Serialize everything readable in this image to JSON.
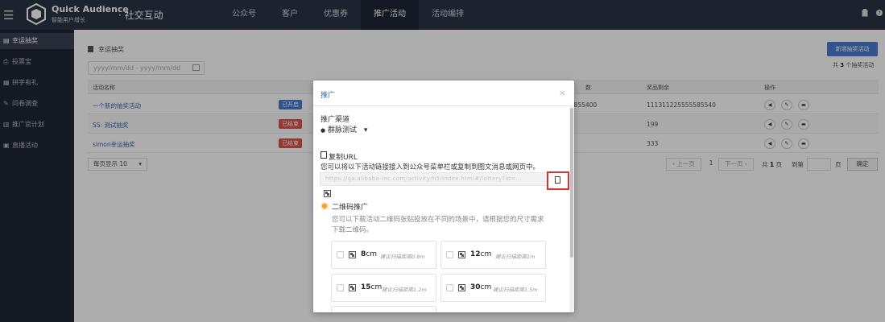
{
  "app": {
    "brand_line1": "Quick Audience",
    "brand_line2": "智能用户增长",
    "section": "· 社交互动"
  },
  "nav": {
    "items": [
      {
        "label": "公众号",
        "active": false
      },
      {
        "label": "客户",
        "active": false
      },
      {
        "label": "优惠券",
        "active": false
      },
      {
        "label": "推广活动",
        "active": true
      },
      {
        "label": "活动编排",
        "active": false
      }
    ]
  },
  "sidebar": {
    "items": [
      {
        "label": "幸运抽奖",
        "icon": "list-icon",
        "active": true
      },
      {
        "label": "投票宝",
        "icon": "vote-icon",
        "active": false
      },
      {
        "label": "拼字有礼",
        "icon": "puzzle-icon",
        "active": false
      },
      {
        "label": "问卷调查",
        "icon": "survey-icon",
        "active": false
      },
      {
        "label": "推广官计划",
        "icon": "promoter-icon",
        "active": false
      },
      {
        "label": "直播活动",
        "icon": "live-icon",
        "active": false
      }
    ]
  },
  "main": {
    "breadcrumb": "幸运抽奖",
    "date_placeholder": "yyyy/mm/dd - yyyy/mm/dd",
    "new_button": "新增抽奖活动",
    "total_prefix": "共",
    "total_count": "3",
    "total_suffix": "个抽奖活动",
    "columns": {
      "name": "活动名称",
      "partial": "数",
      "prize_left": "奖品剩余",
      "ops": "操作"
    },
    "rows": [
      {
        "name": "一个新的抽奖活动",
        "status": "已开启",
        "status_type": "on",
        "col3": "55855400",
        "prize_left": "111311225555585540"
      },
      {
        "name": "SS: 测试抽奖",
        "status": "已结束",
        "status_type": "off",
        "col3": "",
        "prize_left": "199"
      },
      {
        "name": "simon幸运抽奖",
        "status": "已结束",
        "status_type": "off",
        "col3": "",
        "prize_left": "333"
      }
    ],
    "pager": {
      "page_size": "每页显示 10",
      "prev": "‹ 上一页",
      "current": "1",
      "next": "下一页 ›",
      "total_prefix": "共",
      "total_pages": "1",
      "total_suffix": "页",
      "goto": "到第",
      "page_unit": "页",
      "confirm": "确定"
    }
  },
  "modal": {
    "title": "推广",
    "close": "×",
    "channel_label": "推广渠道",
    "channel_value": "群脉测试",
    "copy_url_label": "复制URL",
    "copy_url_desc": "您可以将以下活动链接接入到公众号菜单栏或复制到图文消息或网页中。",
    "url_value": "https://qa.alibaba-inc.com/activity/h5/index.html#/lottery?id=...",
    "qr_label": "二维码推广",
    "qr_desc_line1": "您可以下载活动二维码张贴投放在不同的场景中，请根据您的尺寸需求",
    "qr_desc_line2": "下载二维码。",
    "sizes": [
      {
        "size": "8",
        "unit": "cm",
        "hint": "建议扫描距离0.8m"
      },
      {
        "size": "12",
        "unit": "cm",
        "hint": "建议扫描距离1m"
      },
      {
        "size": "15",
        "unit": "cm",
        "hint": "建议扫描距离1.2m"
      },
      {
        "size": "30",
        "unit": "cm",
        "hint": "建议扫描距离1.5m"
      }
    ]
  },
  "colors": {
    "topbar": "#2b3445",
    "sidebar": "#202633",
    "accent": "#4a7bd0",
    "danger": "#d9534f",
    "highlight": "#d9312b"
  }
}
